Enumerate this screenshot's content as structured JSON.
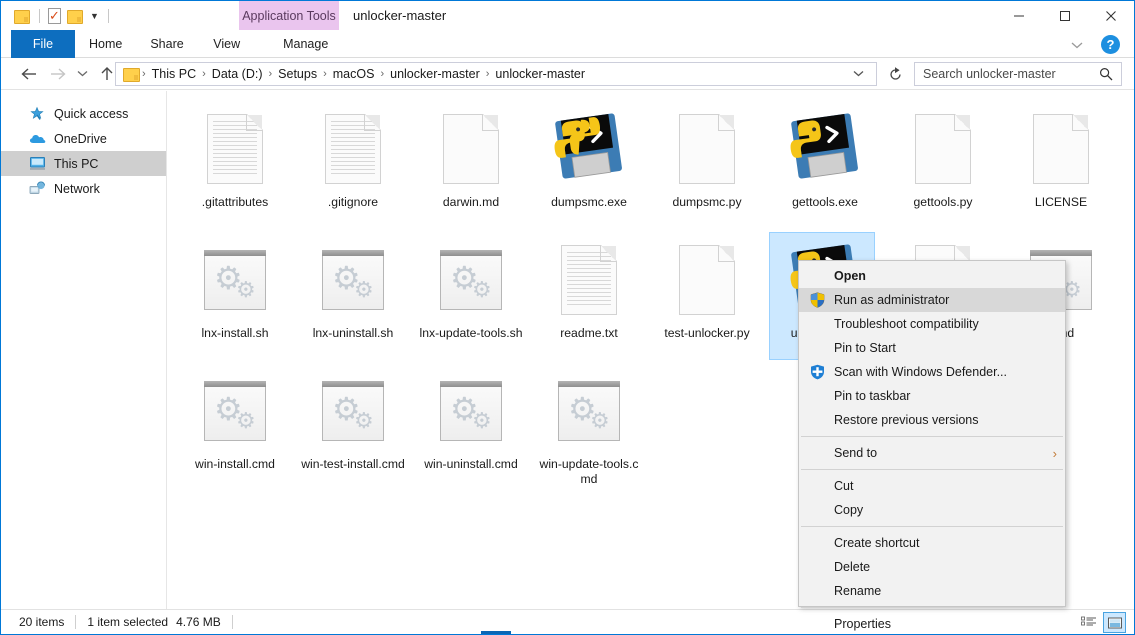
{
  "window": {
    "title": "unlocker-master",
    "contextual_tab_group": "Application Tools",
    "minimize_label": "Minimize",
    "maximize_label": "Maximize",
    "close_label": "Close",
    "ribbon_collapse_label": "chevron-down",
    "help_label": "?"
  },
  "quick_access": {
    "folder_icon": "folder-icon",
    "properties_icon": "properties-icon",
    "new_folder_icon": "new-folder-icon",
    "customize_icon": "chevron-down-icon"
  },
  "ribbon": {
    "tabs": [
      {
        "label": "File",
        "selected": true
      },
      {
        "label": "Home",
        "selected": false
      },
      {
        "label": "Share",
        "selected": false
      },
      {
        "label": "View",
        "selected": false
      },
      {
        "label": "Manage",
        "selected": false
      }
    ]
  },
  "navigation": {
    "back_icon": "back-arrow-icon",
    "forward_icon": "forward-arrow-icon",
    "recent_icon": "chevron-down-icon",
    "up_icon": "up-arrow-icon",
    "refresh_icon": "refresh-icon",
    "breadcrumb": [
      "This PC",
      "Data (D:)",
      "Setups",
      "macOS",
      "unlocker-master",
      "unlocker-master"
    ],
    "breadcrumb_separator": "›",
    "breadcrumb_dropdown_icon": "chevron-down-icon"
  },
  "search": {
    "placeholder": "Search unlocker-master",
    "value": "",
    "icon": "search-icon"
  },
  "sidebar": {
    "items": [
      {
        "label": "Quick access",
        "icon": "star-pin-icon",
        "selected": false
      },
      {
        "label": "OneDrive",
        "icon": "cloud-icon",
        "selected": false
      },
      {
        "label": "This PC",
        "icon": "monitor-icon",
        "selected": true
      },
      {
        "label": "Network",
        "icon": "network-icon",
        "selected": false
      }
    ]
  },
  "files": [
    {
      "name": ".gitattributes",
      "icon": "text-document-icon",
      "selected": false
    },
    {
      "name": ".gitignore",
      "icon": "text-document-icon",
      "selected": false
    },
    {
      "name": "darwin.md",
      "icon": "blank-document-icon",
      "selected": false
    },
    {
      "name": "dumpsmc.exe",
      "icon": "python-exe-icon",
      "selected": false
    },
    {
      "name": "dumpsmc.py",
      "icon": "blank-document-icon",
      "selected": false
    },
    {
      "name": "gettools.exe",
      "icon": "python-exe-icon",
      "selected": false
    },
    {
      "name": "gettools.py",
      "icon": "blank-document-icon",
      "selected": false
    },
    {
      "name": "LICENSE",
      "icon": "blank-document-icon",
      "selected": false
    },
    {
      "name": "lnx-install.sh",
      "icon": "script-icon",
      "selected": false
    },
    {
      "name": "lnx-uninstall.sh",
      "icon": "script-icon",
      "selected": false
    },
    {
      "name": "lnx-update-tools.sh",
      "icon": "script-icon",
      "selected": false
    },
    {
      "name": "readme.txt",
      "icon": "text-document-icon",
      "selected": false
    },
    {
      "name": "test-unlocker.py",
      "icon": "blank-document-icon",
      "selected": false
    },
    {
      "name": "unlocker.exe",
      "icon": "python-exe-icon",
      "selected": true
    },
    {
      "name": "",
      "icon": "blank-document-icon",
      "selected": false
    },
    {
      "name": ".cmd",
      "icon": "script-icon",
      "selected": false
    },
    {
      "name": "win-install.cmd",
      "icon": "script-icon",
      "selected": false
    },
    {
      "name": "win-test-install.cmd",
      "icon": "script-icon",
      "selected": false
    },
    {
      "name": "win-uninstall.cmd",
      "icon": "script-icon",
      "selected": false
    },
    {
      "name": "win-update-tools.cmd",
      "icon": "script-icon",
      "selected": false
    }
  ],
  "context_menu": {
    "items": [
      {
        "label": "Open",
        "bold": true,
        "icon": null,
        "highlighted": false,
        "submenu": false
      },
      {
        "label": "Run as administrator",
        "bold": false,
        "icon": "uac-shield-icon",
        "highlighted": true,
        "submenu": false
      },
      {
        "label": "Troubleshoot compatibility",
        "bold": false,
        "icon": null,
        "highlighted": false,
        "submenu": false
      },
      {
        "label": "Pin to Start",
        "bold": false,
        "icon": null,
        "highlighted": false,
        "submenu": false
      },
      {
        "label": "Scan with Windows Defender...",
        "bold": false,
        "icon": "windows-defender-icon",
        "highlighted": false,
        "submenu": false
      },
      {
        "label": "Pin to taskbar",
        "bold": false,
        "icon": null,
        "highlighted": false,
        "submenu": false
      },
      {
        "label": "Restore previous versions",
        "bold": false,
        "icon": null,
        "highlighted": false,
        "submenu": false
      },
      {
        "separator": true
      },
      {
        "label": "Send to",
        "bold": false,
        "icon": null,
        "highlighted": false,
        "submenu": true
      },
      {
        "separator": true
      },
      {
        "label": "Cut",
        "bold": false,
        "icon": null,
        "highlighted": false,
        "submenu": false
      },
      {
        "label": "Copy",
        "bold": false,
        "icon": null,
        "highlighted": false,
        "submenu": false
      },
      {
        "separator": true
      },
      {
        "label": "Create shortcut",
        "bold": false,
        "icon": null,
        "highlighted": false,
        "submenu": false
      },
      {
        "label": "Delete",
        "bold": false,
        "icon": null,
        "highlighted": false,
        "submenu": false
      },
      {
        "label": "Rename",
        "bold": false,
        "icon": null,
        "highlighted": false,
        "submenu": false
      },
      {
        "separator": true
      },
      {
        "label": "Properties",
        "bold": false,
        "icon": null,
        "highlighted": false,
        "submenu": false
      }
    ],
    "submenu_arrow": "›"
  },
  "status_bar": {
    "item_count": "20 items",
    "selection": "1 item selected",
    "selection_size": "4.76 MB",
    "views": [
      {
        "name": "details-view",
        "active": false
      },
      {
        "name": "large-icons-view",
        "active": true
      }
    ]
  },
  "colors": {
    "accent": "#0d6ebf",
    "contextual_tab": "#eac5ee",
    "selection": "#cce8ff",
    "nav_selected": "#cfcfcf",
    "menu_bg": "#f2f2f2",
    "menu_highlight": "#d8d8d8"
  }
}
